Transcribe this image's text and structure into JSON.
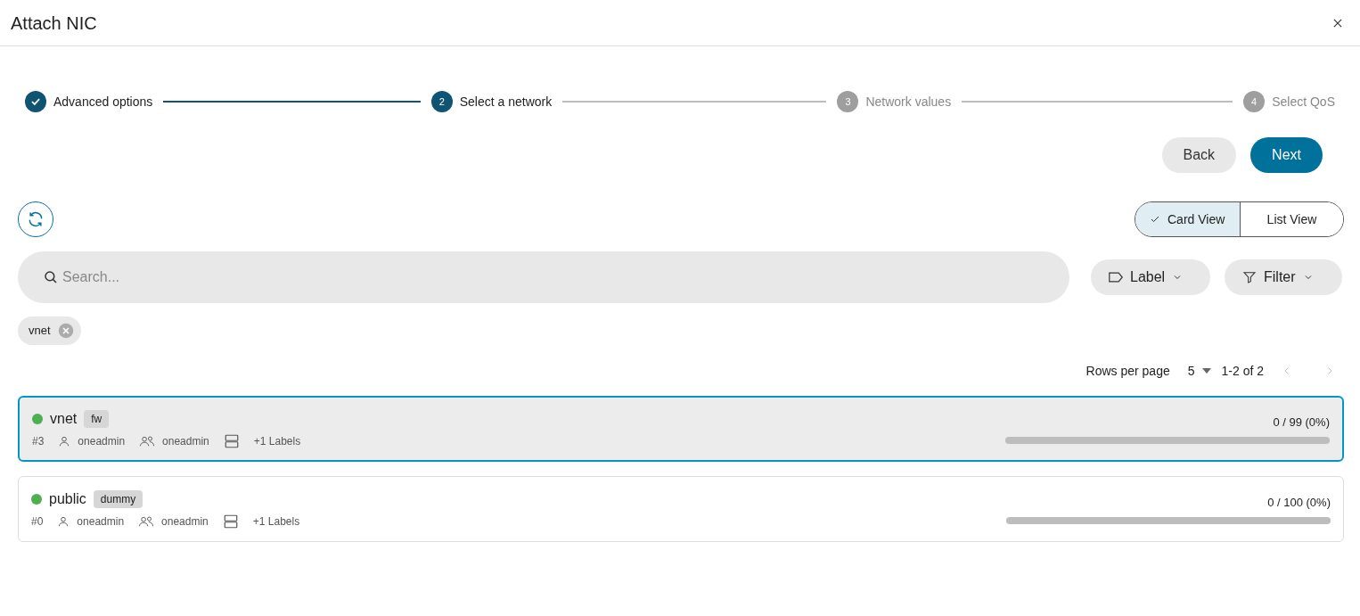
{
  "dialog": {
    "title": "Attach NIC"
  },
  "steps": [
    {
      "label": "Advanced options",
      "kind": "done"
    },
    {
      "label": "Select a network",
      "number": "2",
      "kind": "active"
    },
    {
      "label": "Network values",
      "number": "3",
      "kind": "pending"
    },
    {
      "label": "Select QoS",
      "number": "4",
      "kind": "pending"
    }
  ],
  "actions": {
    "back": "Back",
    "next": "Next"
  },
  "views": [
    {
      "label": "Card View",
      "selected": true
    },
    {
      "label": "List View",
      "selected": false
    }
  ],
  "search": {
    "placeholder": "Search..."
  },
  "filters": [
    {
      "label": "Label",
      "kind": "label"
    },
    {
      "label": "Filter",
      "kind": "filter"
    }
  ],
  "chips": [
    {
      "label": "vnet"
    }
  ],
  "pagination": {
    "rows_label": "Rows per page",
    "rows_value": "5",
    "range": "1-2 of 2"
  },
  "networks": [
    {
      "name": "vnet",
      "tag": "fw",
      "id": "#3",
      "owner": "oneadmin",
      "group": "oneadmin",
      "labels": "+1 Labels",
      "usage": "0 / 99 (0%)",
      "level": 0,
      "color": "#4caf50",
      "selected": true
    },
    {
      "name": "public",
      "tag": "dummy",
      "id": "#0",
      "owner": "oneadmin",
      "group": "oneadmin",
      "labels": "+1 Labels",
      "usage": "0 / 100 (0%)",
      "level": 0,
      "color": "#4caf50",
      "selected": false
    }
  ]
}
